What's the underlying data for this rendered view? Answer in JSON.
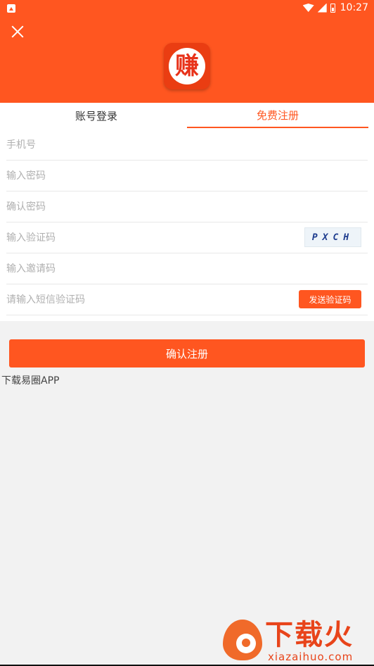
{
  "statusbar": {
    "time": "10:27"
  },
  "tabs": {
    "login": "账号登录",
    "register": "免费注册"
  },
  "logo": {
    "char": "赚"
  },
  "fields": {
    "phone_placeholder": "手机号",
    "password_placeholder": "输入密码",
    "confirm_password_placeholder": "确认密码",
    "captcha_placeholder": "输入验证码",
    "captcha_text": "PXCH",
    "invite_placeholder": "输入邀请码",
    "sms_placeholder": "请输入短信验证码",
    "sms_button": "发送验证码"
  },
  "actions": {
    "submit": "确认注册",
    "download": "下载易圈APP"
  },
  "watermark": {
    "brand": "下载火",
    "domain": "xiazaihuo.com"
  },
  "colors": {
    "accent": "#ff5620",
    "background": "#f2f2f2"
  }
}
